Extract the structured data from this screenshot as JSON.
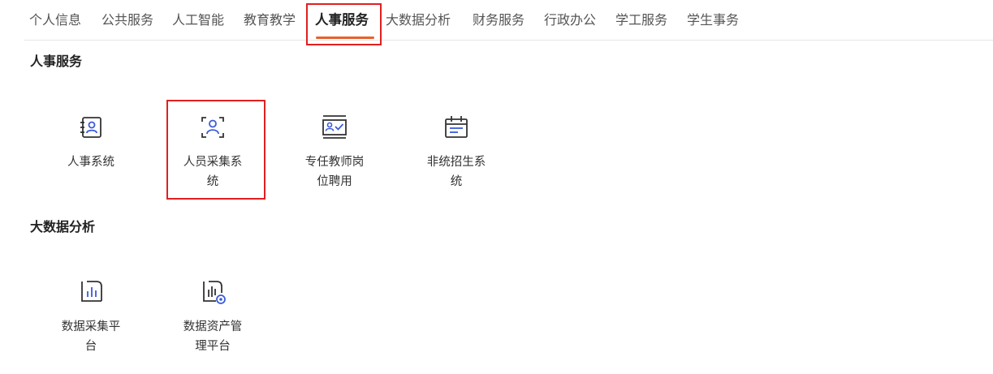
{
  "tabs": [
    {
      "label": "个人信息"
    },
    {
      "label": "公共服务"
    },
    {
      "label": "人工智能"
    },
    {
      "label": "教育教学"
    },
    {
      "label": "人事服务",
      "active": true
    },
    {
      "label": "大数据分析"
    },
    {
      "label": "财务服务"
    },
    {
      "label": "行政办公"
    },
    {
      "label": "学工服务"
    },
    {
      "label": "学生事务"
    }
  ],
  "sections": [
    {
      "title": "人事服务",
      "apps": [
        {
          "label": "人事系统",
          "icon": "person-card-icon"
        },
        {
          "label": "人员采集系统",
          "icon": "person-scan-icon"
        },
        {
          "label": "专任教师岗位聘用",
          "icon": "person-board-check-icon"
        },
        {
          "label": "非统招生系统",
          "icon": "calendar-list-icon"
        }
      ]
    },
    {
      "title": "大数据分析",
      "apps": [
        {
          "label": "数据采集平台",
          "icon": "bar-chart-icon"
        },
        {
          "label": "数据资产管理平台",
          "icon": "bar-chart-gear-icon"
        }
      ]
    }
  ],
  "colors": {
    "accent": "#e8612c",
    "highlight": "#e02020",
    "icon_dark": "#333333",
    "icon_blue": "#3a5bd9"
  }
}
